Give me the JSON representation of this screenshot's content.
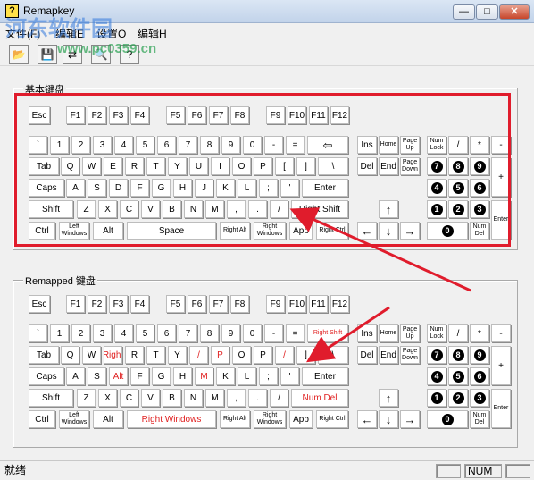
{
  "window": {
    "title": "Remapkey",
    "app_icon": "?",
    "min_glyph": "—",
    "max_glyph": "□",
    "close_glyph": "✕"
  },
  "watermark": {
    "text": "河东软件园",
    "url": "www.pc0359.cn"
  },
  "menu": [
    "文件(F)",
    "编辑E",
    "设置O",
    "编辑H"
  ],
  "toolbar": [
    {
      "name": "open-icon",
      "glyph": "📂"
    },
    {
      "name": "save-icon",
      "glyph": "💾"
    },
    {
      "name": "remap-icon",
      "glyph": "⇄"
    },
    {
      "name": "preview-icon",
      "glyph": "🔍"
    },
    {
      "name": "help-icon",
      "glyph": "?"
    }
  ],
  "base_group_title": "基本键盘",
  "remap_group_title": "Remapped 键盘",
  "base_keys": {
    "fn": [
      "Esc",
      "F1",
      "F2",
      "F3",
      "F4",
      "F5",
      "F6",
      "F7",
      "F8",
      "F9",
      "F10",
      "F11",
      "F12"
    ],
    "row1": [
      "`",
      "1",
      "2",
      "3",
      "4",
      "5",
      "6",
      "7",
      "8",
      "9",
      "0",
      "-",
      "=",
      "⇦"
    ],
    "row2": [
      "Tab",
      "Q",
      "W",
      "E",
      "R",
      "T",
      "Y",
      "U",
      "I",
      "O",
      "P",
      "[",
      "]",
      "\\"
    ],
    "row3": [
      "Caps",
      "A",
      "S",
      "D",
      "F",
      "G",
      "H",
      "J",
      "K",
      "L",
      ";",
      "'",
      "Enter"
    ],
    "row4": [
      "Shift",
      "Z",
      "X",
      "C",
      "V",
      "B",
      "N",
      "M",
      ",",
      ".",
      "/",
      "Right Shift"
    ],
    "row5": [
      "Ctrl",
      "Left Windows",
      "Alt",
      "Space",
      "Right Alt",
      "Right Windows",
      "App",
      "Right Ctrl"
    ]
  },
  "remap_keys": {
    "fn": [
      "Esc",
      "F1",
      "F2",
      "F3",
      "F4",
      "F5",
      "F6",
      "F7",
      "F8",
      "F9",
      "F10",
      "F11",
      "F12"
    ],
    "row1": [
      "`",
      "1",
      "2",
      "3",
      "4",
      "5",
      "6",
      "7",
      "8",
      "9",
      "0",
      "-",
      "=",
      "Right Shift"
    ],
    "row2": [
      "Tab",
      "Q",
      "W",
      "Right",
      "R",
      "T",
      "Y",
      "/",
      "P",
      "O",
      "P",
      "/",
      "]",
      "\\"
    ],
    "row3": [
      "Caps",
      "A",
      "S",
      "Alt",
      "F",
      "G",
      "H",
      "M",
      "K",
      "L",
      ";",
      "'",
      "Enter"
    ],
    "row4": [
      "Shift",
      "Z",
      "X",
      "C",
      "V",
      "B",
      "N",
      "M",
      ",",
      ".",
      "/",
      "Num Del"
    ],
    "row5": [
      "Ctrl",
      "Left Windows",
      "Alt",
      "Right Windows",
      "Right Alt",
      "Right Windows",
      "App",
      "Right Ctrl"
    ]
  },
  "nav_keys": {
    "ins": "Ins",
    "home": "Home",
    "pgup": "Page Up",
    "del": "Del",
    "end": "End",
    "pgdn": "Page Down",
    "up": "↑",
    "left": "←",
    "down": "↓",
    "right": "→"
  },
  "numpad": {
    "numlock": "Num Lock",
    "div": "/",
    "mul": "*",
    "sub": "-",
    "add": "+",
    "enter": "Enter",
    "n7": "7",
    "n8": "8",
    "n9": "9",
    "n4": "4",
    "n5": "5",
    "n6": "6",
    "n1": "1",
    "n2": "2",
    "n3": "3",
    "n0": "0",
    "numdel": "Num Del"
  },
  "status": {
    "text": "就绪",
    "num": "NUM"
  },
  "colors": {
    "highlight": "#e01c2c",
    "remapped_text": "#e02020"
  }
}
